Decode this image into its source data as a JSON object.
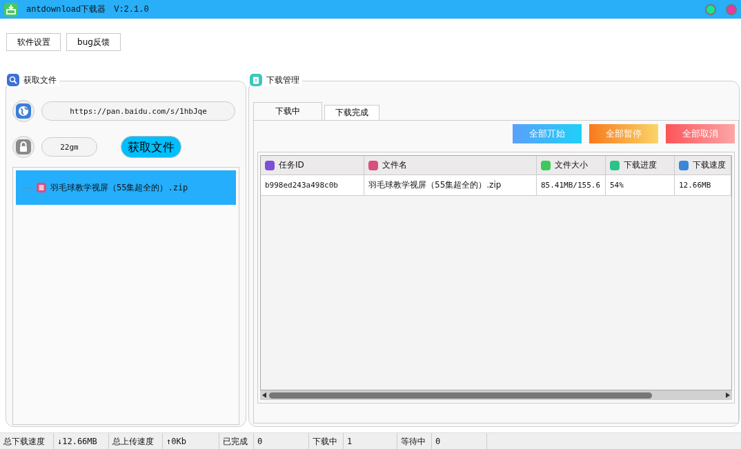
{
  "window": {
    "title": "antdownload下载器",
    "version": "V:2.1.0"
  },
  "toolbar": [
    "软件设置",
    "bug反馈"
  ],
  "fetch_panel": {
    "title": "获取文件",
    "url": "https://pan.baidu.com/s/1hbJqe",
    "code": "22gm",
    "fetch_button": "获取文件",
    "files": [
      {
        "name": "羽毛球教学视屏（55集超全的）.zip",
        "selected": true
      }
    ]
  },
  "download_panel": {
    "title": "下载管理",
    "tabs": [
      {
        "label": "下载中",
        "selected": true
      },
      {
        "label": "下载完成",
        "selected": false
      }
    ],
    "actions": [
      {
        "label": "全部丌始",
        "kind": "start"
      },
      {
        "label": "全部暂停",
        "kind": "pause"
      },
      {
        "label": "全部取消",
        "kind": "cancel"
      }
    ],
    "table": {
      "columns": [
        {
          "label": "任务ID",
          "kind": "edit"
        },
        {
          "label": "文件名",
          "kind": "file"
        },
        {
          "label": "文件大小",
          "kind": "size"
        },
        {
          "label": "下载进度",
          "kind": "check"
        },
        {
          "label": "下载速度",
          "kind": "globe"
        }
      ],
      "rows": [
        [
          "b998ed243a498c0b",
          "羽毛球教学视屏（55集超全的）.zip",
          "85.41MB/155.6",
          "54%",
          "12.66MB"
        ]
      ]
    }
  },
  "status_bar": [
    {
      "label": "总下载速度",
      "value": "↓12.66MB"
    },
    {
      "label": "总上传速度",
      "value": "↑0Kb"
    },
    {
      "label": "已完成",
      "value": "0"
    },
    {
      "label": "下载中",
      "value": "1"
    },
    {
      "label": "等待中",
      "value": "0"
    }
  ]
}
